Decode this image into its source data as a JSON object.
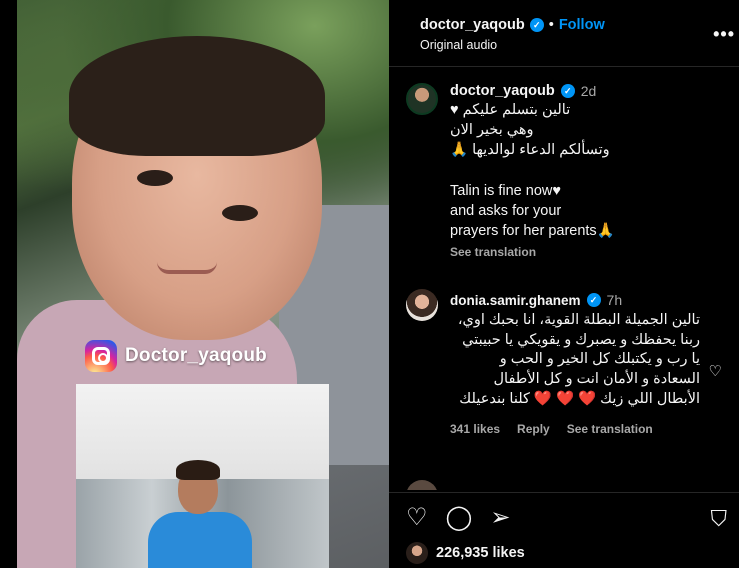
{
  "header": {
    "username": "doctor_yaqoub",
    "separator": "•",
    "follow_label": "Follow",
    "audio": "Original audio",
    "more_icon": "more-horizontal-icon"
  },
  "media": {
    "watermark": "Doctor_yaqoub"
  },
  "caption": {
    "username": "doctor_yaqoub",
    "age": "2d",
    "arabic_text": "تالين بتسلم عليكم ♥\nوهي بخير الان\nوتسألكم الدعاء لوالديها 🙏",
    "english_text": "\nTalin is fine now♥\nand asks for your\nprayers for her parents🙏",
    "see_translation": "See translation"
  },
  "comment": {
    "username": "donia.samir.ghanem",
    "age": "7h",
    "text": "تالين الجميلة البطلة القوية، انا بحبك اوي، ربنا يحفظك و يصبرك و يقويكي يا حبيبتي يا رب و يكتبلك كل الخير و الحب و السعادة و الأمان انت و كل الأطفال الأبطال اللي زيك ❤️ ❤️ ❤️ كلنا بندعيلك",
    "likes": "341 likes",
    "reply": "Reply",
    "see_translation": "See translation"
  },
  "actions": {
    "likes_count": "226,935 likes"
  },
  "colors": {
    "accent": "#0095f6",
    "background": "#000000",
    "secondary_text": "#a8a8a8"
  }
}
